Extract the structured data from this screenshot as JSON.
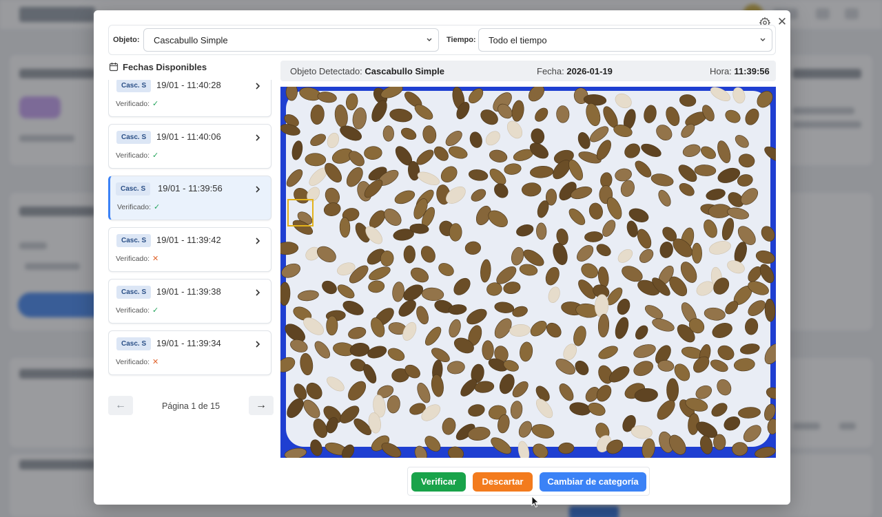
{
  "modal": {
    "object_label": "Objeto:",
    "object_value": "Cascabullo Simple",
    "time_label": "Tiempo:",
    "time_value": "Todo el tiempo",
    "dates_title": "Fechas Disponibles"
  },
  "items": [
    {
      "badge": "Casc. S",
      "time": "19/01 - 11:40:28",
      "verified_label": "Verificado:",
      "verified": "✓",
      "status": "ok",
      "active": false
    },
    {
      "badge": "Casc. S",
      "time": "19/01 - 11:40:06",
      "verified_label": "Verificado:",
      "verified": "✓",
      "status": "ok",
      "active": false
    },
    {
      "badge": "Casc. S",
      "time": "19/01 - 11:39:56",
      "verified_label": "Verificado:",
      "verified": "✓",
      "status": "ok",
      "active": true
    },
    {
      "badge": "Casc. S",
      "time": "19/01 - 11:39:42",
      "verified_label": "Verificado:",
      "verified": "✕",
      "status": "no",
      "active": false
    },
    {
      "badge": "Casc. S",
      "time": "19/01 - 11:39:38",
      "verified_label": "Verificado:",
      "verified": "✓",
      "status": "ok",
      "active": false
    },
    {
      "badge": "Casc. S",
      "time": "19/01 - 11:39:34",
      "verified_label": "Verificado:",
      "verified": "✕",
      "status": "no",
      "active": false
    }
  ],
  "pagination": {
    "prev": "←",
    "next": "→",
    "text": "Página 1 de 15"
  },
  "detail": {
    "object_label": "Objeto Detectado:",
    "object_value": "Cascabullo Simple",
    "date_label": "Fecha:",
    "date_value": "2026-01-19",
    "hour_label": "Hora:",
    "hour_value": "11:39:56"
  },
  "actions": {
    "verify": "Verificar",
    "discard": "Descartar",
    "change": "Cambiar de categoría"
  },
  "colors": {
    "accent": "#3b82f6",
    "verify": "#19a34a",
    "discard": "#f37b1d",
    "ok": "#22a35a",
    "no": "#e0632b",
    "detection_box": "#e3b21a"
  }
}
